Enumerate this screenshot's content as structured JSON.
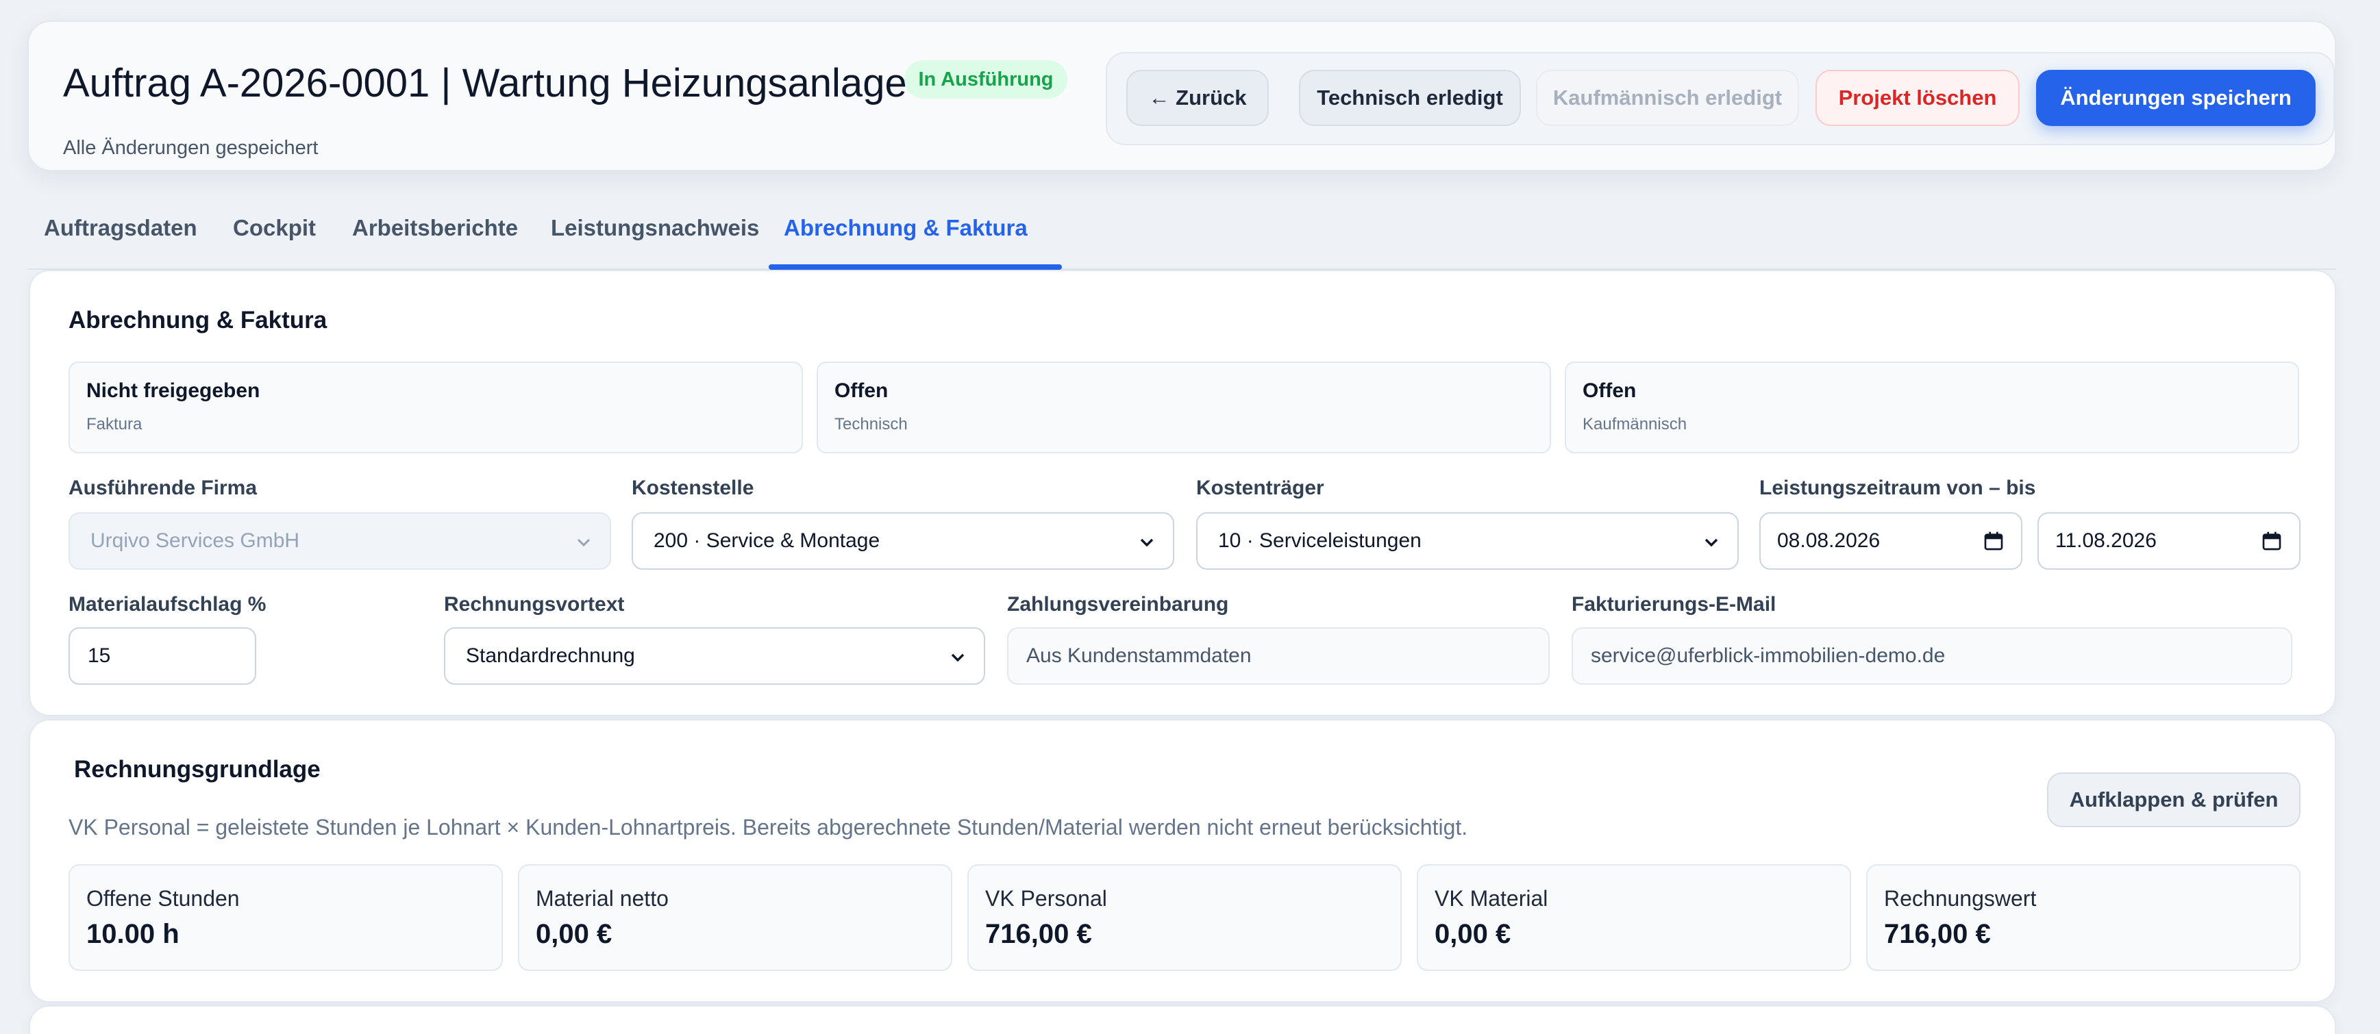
{
  "header": {
    "title": "Auftrag A-2026-0001 | Wartung Heizungsanlage",
    "status": "In Ausführung",
    "save_status": "Alle Änderungen gespeichert",
    "buttons": {
      "back": "← Zurück",
      "tech_done": "Technisch erledigt",
      "kauf_done": "Kaufmännisch erledigt",
      "delete": "Projekt löschen",
      "save": "Änderungen speichern"
    }
  },
  "tabs": [
    "Auftragsdaten",
    "Cockpit",
    "Arbeitsberichte",
    "Leistungsnachweis",
    "Abrechnung & Faktura"
  ],
  "active_tab": "Abrechnung & Faktura",
  "billing": {
    "title": "Abrechnung & Faktura",
    "status_boxes": [
      {
        "value": "Nicht freigegeben",
        "label": "Faktura"
      },
      {
        "value": "Offen",
        "label": "Technisch"
      },
      {
        "value": "Offen",
        "label": "Kaufmännisch"
      }
    ],
    "fields": {
      "company": {
        "label": "Ausführende Firma",
        "value": "Urqivo Services GmbH"
      },
      "cost_center": {
        "label": "Kostenstelle",
        "value": "200 · Service & Montage"
      },
      "cost_unit": {
        "label": "Kostenträger",
        "value": "10 · Serviceleistungen"
      },
      "period": {
        "label": "Leistungszeitraum von – bis",
        "from": "08.08.2026",
        "to": "11.08.2026"
      },
      "material_markup": {
        "label": "Materialaufschlag %",
        "value": "15"
      },
      "invoice_pretext": {
        "label": "Rechnungsvortext",
        "value": "Standardrechnung"
      },
      "payment_terms": {
        "label": "Zahlungsvereinbarung",
        "value": "Aus Kundenstammdaten"
      },
      "billing_email": {
        "label": "Fakturierungs-E-Mail",
        "value": "service@uferblick-immobilien-demo.de"
      }
    }
  },
  "invoice_basis": {
    "title": "Rechnungsgrundlage",
    "hint": "VK Personal = geleistete Stunden je Lohnart × Kunden-Lohnartpreis. Bereits abgerechnete Stunden/Material werden nicht erneut berücksichtigt.",
    "expand_button": "Aufklappen & prüfen",
    "metrics": [
      {
        "label": "Offene Stunden",
        "value": "10.00 h"
      },
      {
        "label": "Material netto",
        "value": "0,00 €"
      },
      {
        "label": "VK Personal",
        "value": "716,00 €"
      },
      {
        "label": "VK Material",
        "value": "0,00 €"
      },
      {
        "label": "Rechnungswert",
        "value": "716,00 €"
      }
    ]
  },
  "colors": {
    "accent": "#2563eb",
    "status_green": "#16a34a",
    "danger": "#dc2626"
  }
}
